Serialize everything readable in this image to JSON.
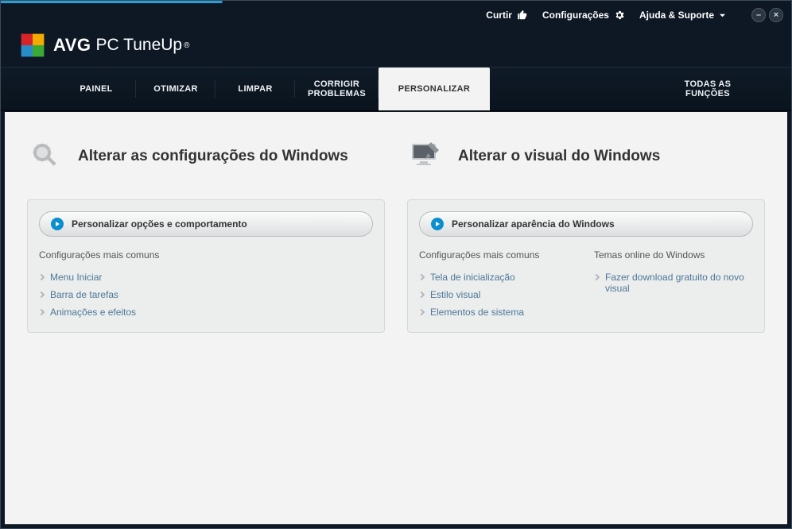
{
  "brand": {
    "name": "AVG",
    "product": "PC TuneUp"
  },
  "toplinks": {
    "like": "Curtir",
    "settings": "Configurações",
    "help": "Ajuda & Suporte"
  },
  "tabs": [
    {
      "label": "PAINEL",
      "active": false
    },
    {
      "label": "OTIMIZAR",
      "active": false
    },
    {
      "label": "LIMPAR",
      "active": false
    },
    {
      "label": "CORRIGIR\nPROBLEMAS",
      "active": false
    },
    {
      "label": "PERSONALIZAR",
      "active": true
    },
    {
      "label": "TODAS AS\nFUNÇÕES",
      "active": false
    }
  ],
  "left": {
    "title": "Alterar as configurações do Windows",
    "button": "Personalizar opções e comportamento",
    "sub1_head": "Configurações mais comuns",
    "sub1_items": [
      "Menu Iniciar",
      "Barra de tarefas",
      "Animações e efeitos"
    ]
  },
  "right": {
    "title": "Alterar o visual do Windows",
    "button": "Personalizar aparência do Windows",
    "sub1_head": "Configurações mais comuns",
    "sub1_items": [
      "Tela de inicialização",
      "Estilo visual",
      "Elementos de sistema"
    ],
    "sub2_head": "Temas online do Windows",
    "sub2_items": [
      "Fazer download gratuito do novo visual"
    ]
  }
}
